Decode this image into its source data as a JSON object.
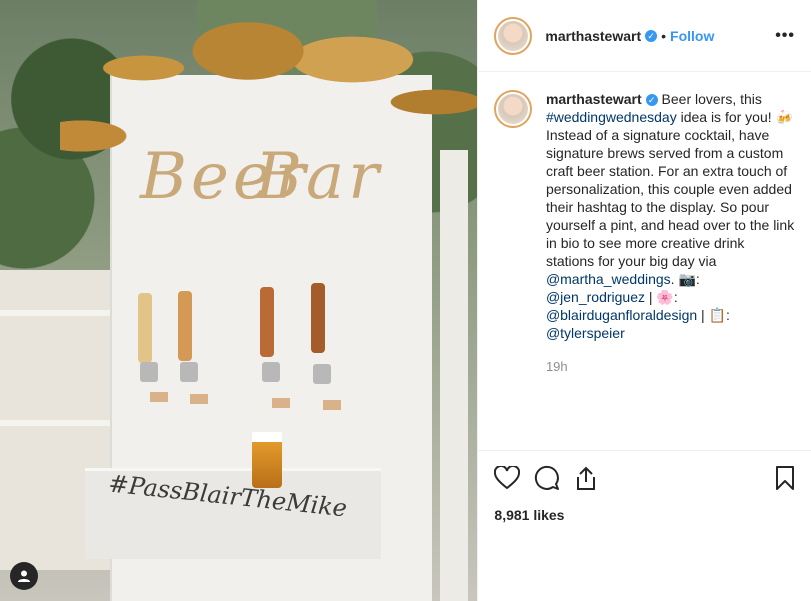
{
  "header": {
    "username": "marthastewart",
    "separator": "•",
    "follow_label": "Follow",
    "more_label": "•••"
  },
  "photo": {
    "sign_left": "Beer",
    "sign_right": "Bar",
    "hashtag_script": "#PassBlairTheMike"
  },
  "caption": {
    "username": "marthastewart",
    "t1": " Beer lovers, this ",
    "hashtag": "#weddingwednesday",
    "t2": " idea is for you! 🍻 Instead of a signature cocktail, have signature brews served from a custom craft beer station. For an extra touch of personalization, this couple even added their hashtag to the display. So pour yourself a pint, and head over to the link in bio to see more creative drink stations for your big day via ",
    "mention_weddings": "@martha_weddings",
    "t3": ". 📷: ",
    "mention_photo": "@jen_rodriguez",
    "t4": " | 🌸: ",
    "mention_floral": "@blairduganfloraldesign",
    "t5": " | 📋: ",
    "mention_planner": "@tylerspeier",
    "time": "19h"
  },
  "actions": {
    "likes": "8,981 likes",
    "like_icon": "heart-icon",
    "comment_icon": "comment-icon",
    "share_icon": "share-icon",
    "save_icon": "bookmark-icon"
  },
  "colors": {
    "accent": "#3897f0",
    "link": "#00376b",
    "muted": "#8e8e8e"
  }
}
